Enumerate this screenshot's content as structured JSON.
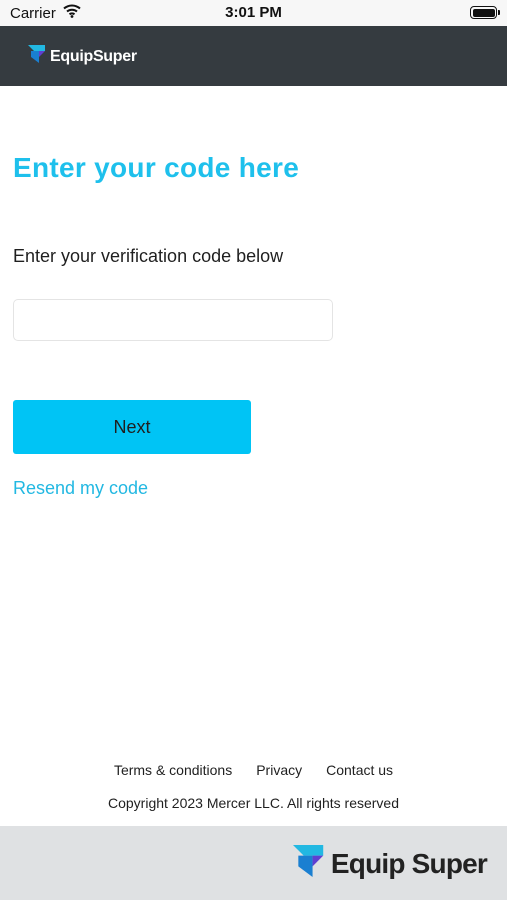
{
  "status_bar": {
    "carrier": "Carrier",
    "time": "3:01 PM"
  },
  "header": {
    "logo_text": "EquipSuper"
  },
  "main": {
    "title": "Enter your code here",
    "instruction": "Enter your verification code below",
    "code_input": {
      "value": "",
      "placeholder": ""
    },
    "next_label": "Next",
    "resend_label": "Resend my code"
  },
  "footer": {
    "links": [
      "Terms & conditions",
      "Privacy",
      "Contact us"
    ],
    "copyright": "Copyright 2023 Mercer LLC. All rights reserved",
    "logo_text": "Equip Super"
  },
  "colors": {
    "accent": "#1ec0ec",
    "button": "#00c4f5",
    "header_bg": "#353b40",
    "footer_bg": "#dfe1e3"
  }
}
